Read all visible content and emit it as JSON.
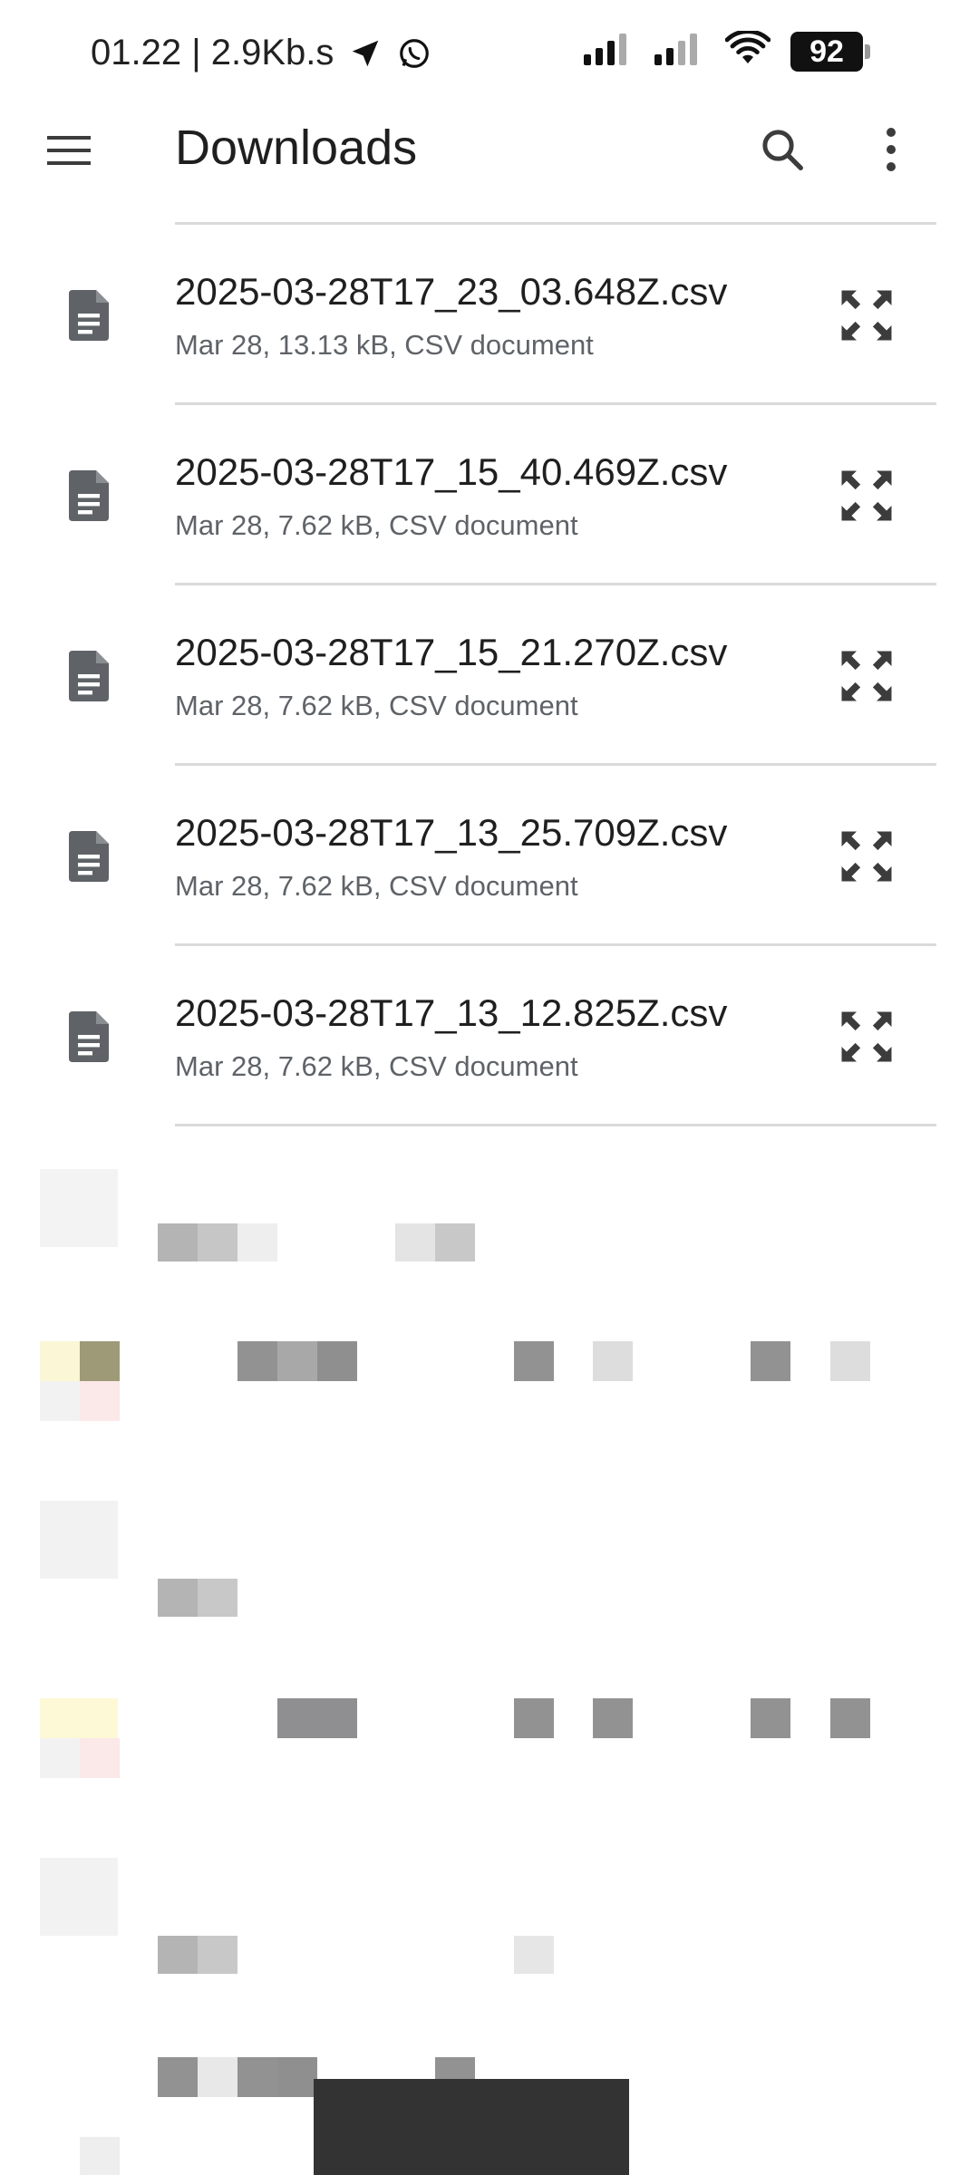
{
  "status_bar": {
    "time_speed": "01.22 | 2.9Kb.s",
    "battery": "92"
  },
  "app_bar": {
    "title": "Downloads"
  },
  "files": [
    {
      "name": "2025-03-28T17_23_03.648Z.csv",
      "meta": "Mar 28, 13.13 kB, CSV document"
    },
    {
      "name": "2025-03-28T17_15_40.469Z.csv",
      "meta": "Mar 28, 7.62 kB, CSV document"
    },
    {
      "name": "2025-03-28T17_15_21.270Z.csv",
      "meta": "Mar 28, 7.62 kB, CSV document"
    },
    {
      "name": "2025-03-28T17_13_25.709Z.csv",
      "meta": "Mar 28, 7.62 kB, CSV document"
    },
    {
      "name": "2025-03-28T17_13_12.825Z.csv",
      "meta": "Mar 28, 7.62 kB, CSV document"
    }
  ],
  "icons": {
    "menu": "menu-icon",
    "search": "search-icon",
    "more": "more-vert-icon",
    "file": "document-icon",
    "expand": "expand-icon"
  },
  "colors": {
    "text_primary": "#1f1f1f",
    "text_secondary": "#5f6368",
    "icon": "#5f6368",
    "divider": "#dadada"
  }
}
